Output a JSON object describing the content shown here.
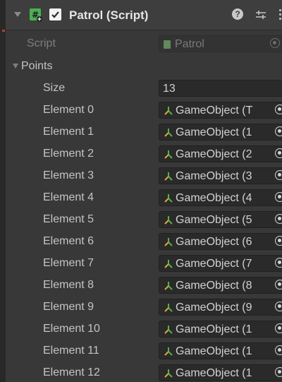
{
  "component": {
    "title": "Patrol (Script)",
    "help_glyph": "?",
    "script_label": "Script",
    "script_value": "Patrol"
  },
  "points": {
    "label": "Points",
    "size_label": "Size",
    "size_value": "13",
    "elements": [
      {
        "label": "Element 0",
        "value": "GameObject (T"
      },
      {
        "label": "Element 1",
        "value": "GameObject (1"
      },
      {
        "label": "Element 2",
        "value": "GameObject (2"
      },
      {
        "label": "Element 3",
        "value": "GameObject (3"
      },
      {
        "label": "Element 4",
        "value": "GameObject (4"
      },
      {
        "label": "Element 5",
        "value": "GameObject (5"
      },
      {
        "label": "Element 6",
        "value": "GameObject (6"
      },
      {
        "label": "Element 7",
        "value": "GameObject (7"
      },
      {
        "label": "Element 8",
        "value": "GameObject (8"
      },
      {
        "label": "Element 9",
        "value": "GameObject (9"
      },
      {
        "label": "Element 10",
        "value": "GameObject (1"
      },
      {
        "label": "Element 11",
        "value": "GameObject (1"
      },
      {
        "label": "Element 12",
        "value": "GameObject (1"
      }
    ]
  },
  "colors": {
    "panel_bg": "#383838",
    "field_bg": "#2a2a2a",
    "text": "#c4c4c4",
    "script_icon_green": "#4caf50",
    "gameobject_icon_orange": "#e8a33a",
    "gameobject_icon_green": "#55b04a"
  },
  "icons": {
    "script": "cs-script-icon",
    "gameobject": "gameobject-icon",
    "picker": "object-picker-icon",
    "settings": "preset-settings-icon",
    "menu": "kebab-menu-icon"
  }
}
